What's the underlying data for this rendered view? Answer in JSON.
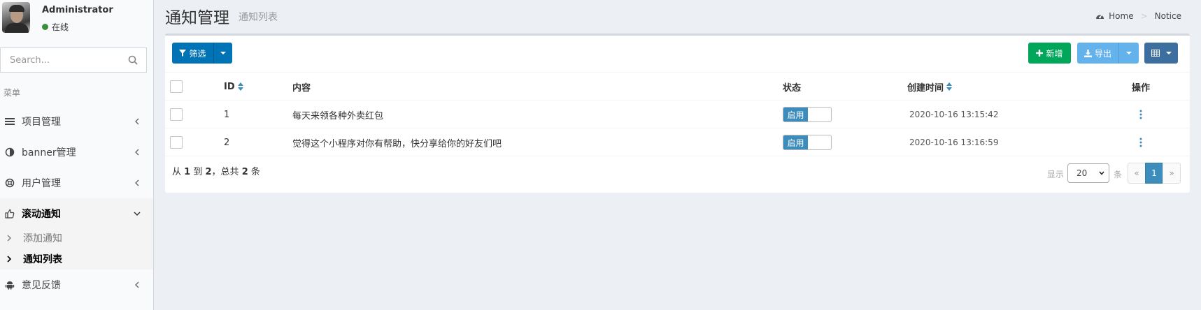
{
  "user": {
    "name": "Administrator",
    "status": "在线"
  },
  "search": {
    "placeholder": "Search..."
  },
  "menu": {
    "header": "菜单",
    "items": [
      {
        "label": "项目管理",
        "icon": "list-icon"
      },
      {
        "label": "banner管理",
        "icon": "adjust-icon"
      },
      {
        "label": "用户管理",
        "icon": "life-ring-icon"
      },
      {
        "label": "滚动通知",
        "icon": "thumbs-up-icon",
        "expanded": true
      },
      {
        "label": "意见反馈",
        "icon": "android-icon"
      }
    ],
    "submenu": [
      {
        "label": "添加通知"
      },
      {
        "label": "通知列表",
        "current": true
      }
    ]
  },
  "page": {
    "title": "通知管理",
    "subtitle": "通知列表"
  },
  "breadcrumb": {
    "home": "Home",
    "current": "Notice"
  },
  "toolbar": {
    "filter": "筛选",
    "new": "新增",
    "export": "导出"
  },
  "table": {
    "headers": {
      "id": "ID",
      "content": "内容",
      "status": "状态",
      "created": "创建时间",
      "actions": "操作"
    },
    "rows": [
      {
        "id": "1",
        "content": "每天来领各种外卖红包",
        "status": "启用",
        "created": "2020-10-16 13:15:42"
      },
      {
        "id": "2",
        "content": "觉得这个小程序对你有帮助，快分享给你的好友们吧",
        "status": "启用",
        "created": "2020-10-16 13:16:59"
      }
    ]
  },
  "footer": {
    "prefix": "从",
    "from": "1",
    "to_word": "到",
    "to": "2",
    "total_word": "，总共",
    "total": "2",
    "suffix": "条",
    "show_label": "显示",
    "per_page": "20",
    "per_page_unit": "条",
    "pager_prev": "«",
    "pager_page": "1",
    "pager_next": "»"
  },
  "colors": {
    "primary": "#3c8dbc",
    "success": "#00a65a",
    "filter_btn": "#0073b7",
    "export_btn": "#64b2eb"
  }
}
